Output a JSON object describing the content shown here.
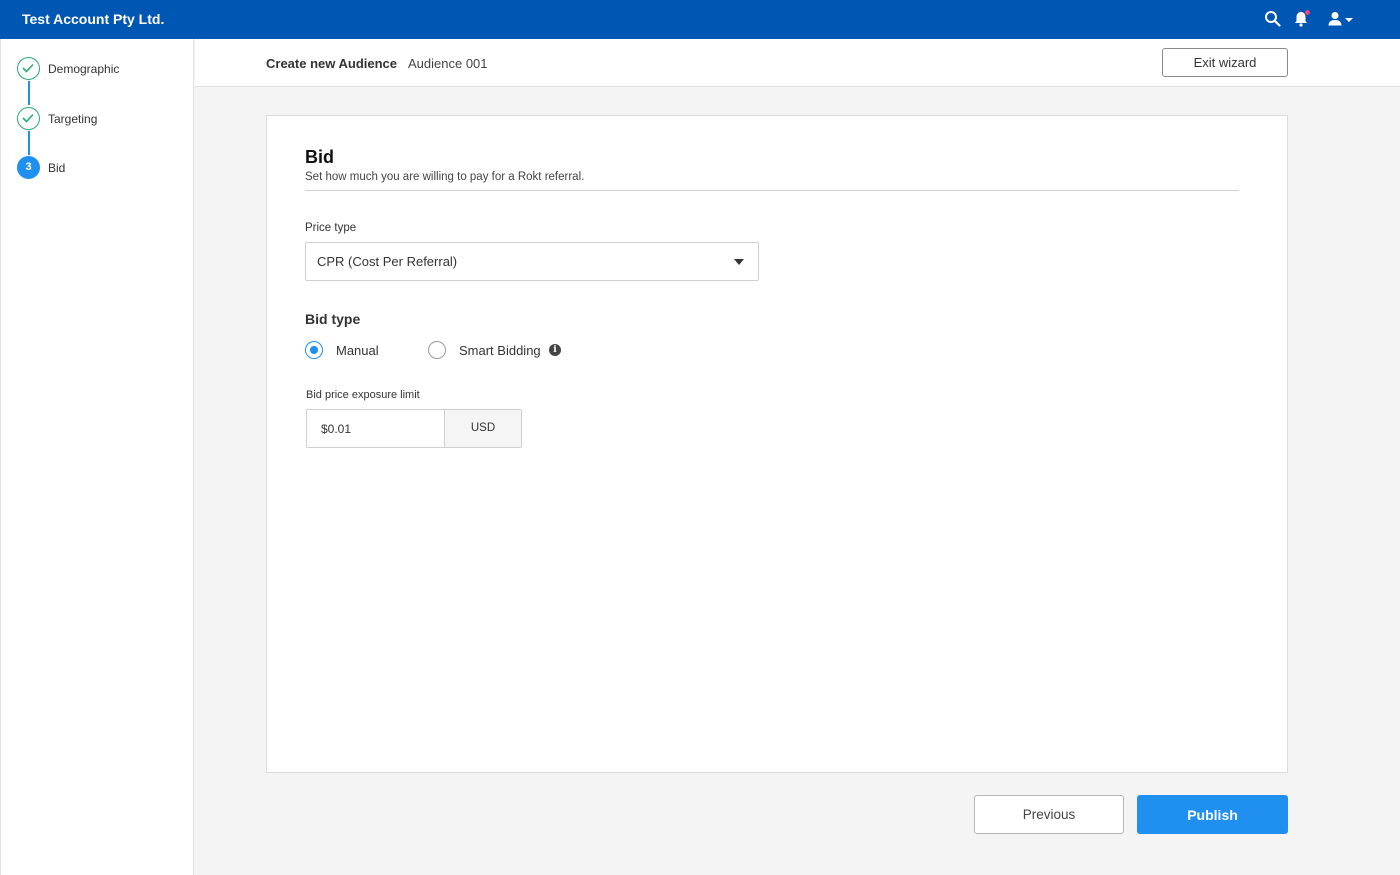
{
  "topbar": {
    "account_name": "Test Account Pty Ltd.",
    "icons": [
      "search-icon",
      "bell-icon",
      "user-icon",
      "chevron-down-icon"
    ],
    "notification_dot_color": "#e8467c",
    "bg_color": "#0057b3"
  },
  "steps": [
    {
      "label": "Demographic",
      "status": "complete"
    },
    {
      "label": "Targeting",
      "status": "complete"
    },
    {
      "label": "Bid",
      "status": "current",
      "number": "3"
    }
  ],
  "header": {
    "title": "Create new Audience",
    "audience_name": "Audience 001",
    "exit_label": "Exit wizard"
  },
  "bid": {
    "title": "Bid",
    "subtitle": "Set how much you are willing to pay for a Rokt referral.",
    "price_type_label": "Price type",
    "price_type_value": "CPR (Cost Per Referral)",
    "bid_type_label": "Bid type",
    "bid_options": [
      {
        "label": "Manual",
        "selected": true
      },
      {
        "label": "Smart Bidding",
        "selected": false
      }
    ],
    "info_glyph": "i",
    "limit_label": "Bid price exposure limit",
    "limit_value": "$0.01",
    "limit_unit": "USD"
  },
  "footer": {
    "previous_label": "Previous",
    "publish_label": "Publish"
  },
  "colors": {
    "accent": "#1f8ff0",
    "success": "#2aa876"
  }
}
